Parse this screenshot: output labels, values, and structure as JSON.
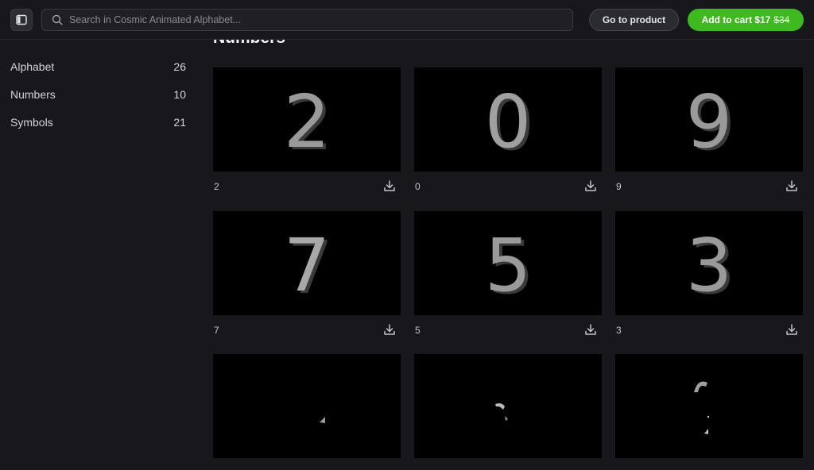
{
  "search": {
    "placeholder": "Search in Cosmic Animated Alphabet..."
  },
  "header": {
    "go_to_product": "Go to product",
    "add_to_cart": "Add to cart $17",
    "old_price": "$34"
  },
  "sidebar": {
    "items": [
      {
        "label": "Alphabet",
        "count": "26"
      },
      {
        "label": "Numbers",
        "count": "10"
      },
      {
        "label": "Symbols",
        "count": "21"
      }
    ]
  },
  "main": {
    "section_title": "Numbers",
    "cards": [
      {
        "glyph": "2",
        "caption": "2"
      },
      {
        "glyph": "0",
        "caption": "0"
      },
      {
        "glyph": "9",
        "caption": "9"
      },
      {
        "glyph": "7",
        "caption": "7"
      },
      {
        "glyph": "5",
        "caption": "5"
      },
      {
        "glyph": "3",
        "caption": "3"
      },
      {
        "glyph": "",
        "caption": ""
      },
      {
        "glyph": "",
        "caption": ""
      },
      {
        "glyph": "",
        "caption": ""
      }
    ]
  },
  "colors": {
    "accent": "#3fb920",
    "background": "#17171c",
    "thumb": "#000000"
  }
}
